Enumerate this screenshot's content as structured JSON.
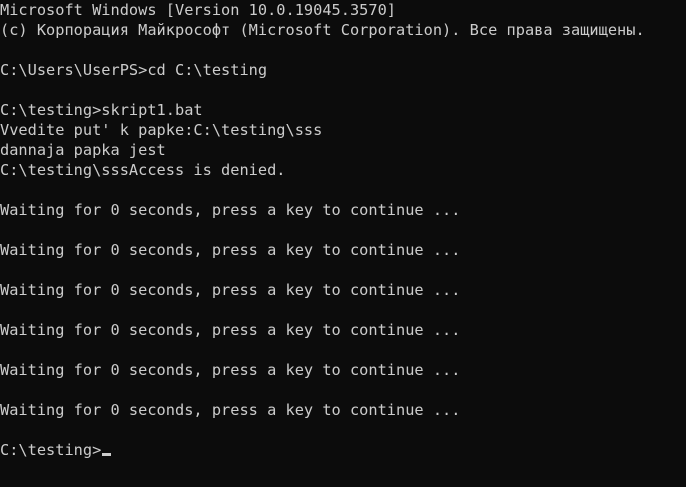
{
  "terminal": {
    "foreground": "#cccccc",
    "background": "#0c0c0c",
    "lines": [
      "Microsoft Windows [Version 10.0.19045.3570]",
      "(c) Корпорация Майкрософт (Microsoft Corporation). Все права защищены.",
      "",
      "C:\\Users\\UserPS>cd C:\\testing",
      "",
      "C:\\testing>skript1.bat",
      "Vvedite put' k papke:C:\\testing\\sss",
      "dannaja papka jest",
      "C:\\testing\\sssAccess is denied.",
      "",
      "Waiting for 0 seconds, press a key to continue ...",
      "",
      "Waiting for 0 seconds, press a key to continue ...",
      "",
      "Waiting for 0 seconds, press a key to continue ...",
      "",
      "Waiting for 0 seconds, press a key to continue ...",
      "",
      "Waiting for 0 seconds, press a key to continue ...",
      "",
      "Waiting for 0 seconds, press a key to continue ...",
      ""
    ],
    "prompt": "C:\\testing>"
  }
}
